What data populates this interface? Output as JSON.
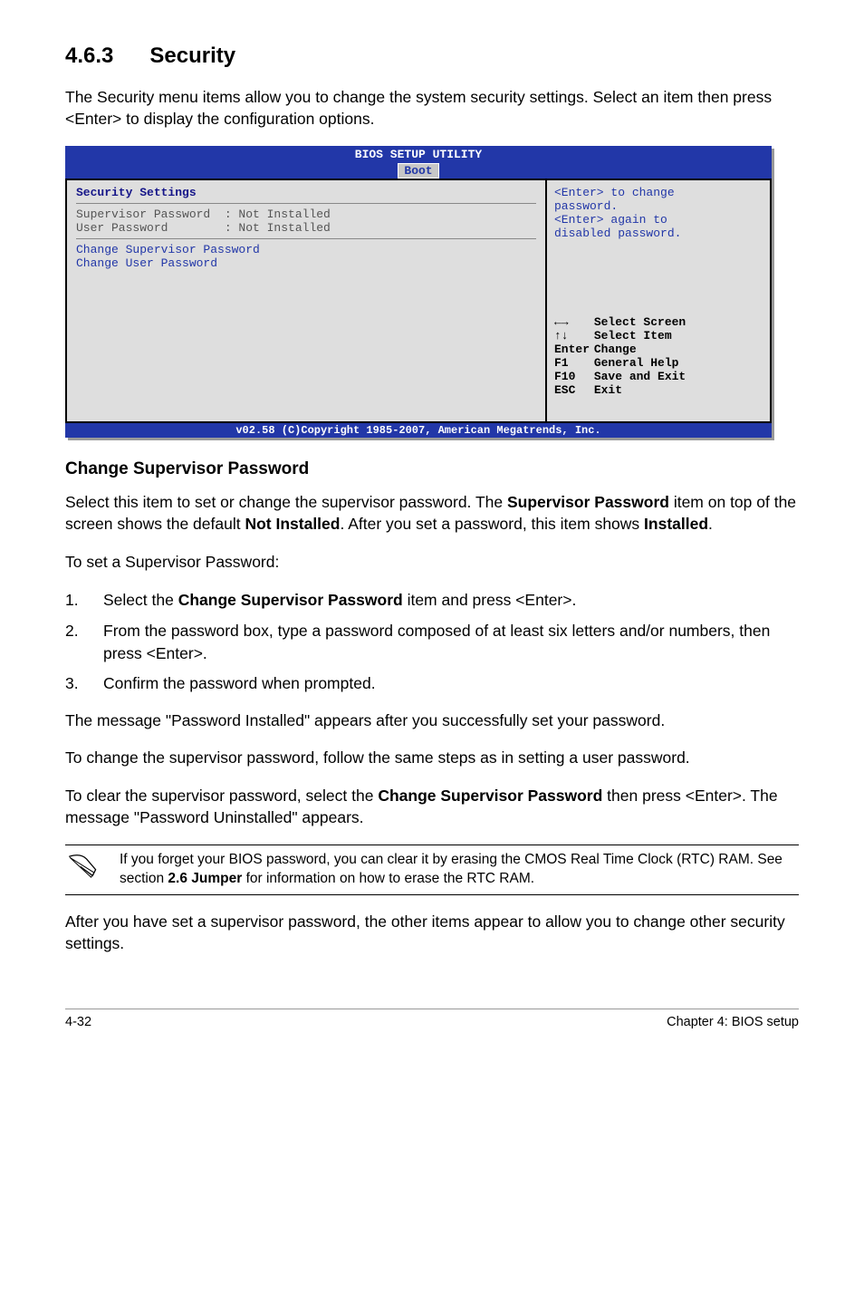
{
  "heading": {
    "number": "4.6.3",
    "title": "Security"
  },
  "intro": "The Security menu items allow you to change the system security settings. Select an item then press <Enter> to display the configuration options.",
  "bios": {
    "title": "BIOS SETUP UTILITY",
    "tab": "Boot",
    "left": {
      "sec_title": "Security Settings",
      "row1": "Supervisor Password  : Not Installed",
      "row2": "User Password        : Not Installed",
      "blue1": "Change Supervisor Password",
      "blue2": "Change User Password"
    },
    "right": {
      "help_top": "<Enter> to change\npassword.\n<Enter> again to\ndisabled password.",
      "nav": {
        "l1a": "←→",
        "l1b": "Select Screen",
        "l2a": "↑↓",
        "l2b": "Select Item",
        "l3a": "Enter",
        "l3b": "Change",
        "l4a": "F1",
        "l4b": "General Help",
        "l5a": "F10",
        "l5b": "Save and Exit",
        "l6a": "ESC",
        "l6b": "Exit"
      }
    },
    "footer": "v02.58 (C)Copyright 1985-2007, American Megatrends, Inc."
  },
  "subhead": "Change Supervisor Password",
  "p1a": "Select this item to set or change the supervisor password. The ",
  "p1b": "Supervisor Password",
  "p1c": " item on top of the screen shows the default ",
  "p1d": "Not Installed",
  "p1e": ". After you set a password, this item shows ",
  "p1f": "Installed",
  "p1g": ".",
  "p2": "To set a Supervisor Password:",
  "steps": {
    "s1a": "Select the ",
    "s1b": "Change Supervisor Password",
    "s1c": " item and press <Enter>.",
    "s2": "From the password box, type a password composed of at least six letters and/or numbers, then press <Enter>.",
    "s3": "Confirm the password when prompted."
  },
  "p3": "The message \"Password Installed\" appears after you successfully set your password.",
  "p4": "To change the supervisor password, follow the same steps as in setting a user password.",
  "p5a": "To clear the supervisor password, select the ",
  "p5b": "Change Supervisor Password",
  "p5c": " then press <Enter>. The message \"Password Uninstalled\" appears.",
  "note_a": "If you forget your BIOS password, you can clear it by erasing the CMOS Real Time Clock (RTC) RAM. See section ",
  "note_b": "2.6 Jumper",
  "note_c": " for information on how to erase the RTC RAM.",
  "p6": "After you have set a supervisor password, the other items appear to allow you to change other security settings.",
  "footer": {
    "left": "4-32",
    "right": "Chapter 4: BIOS setup"
  }
}
